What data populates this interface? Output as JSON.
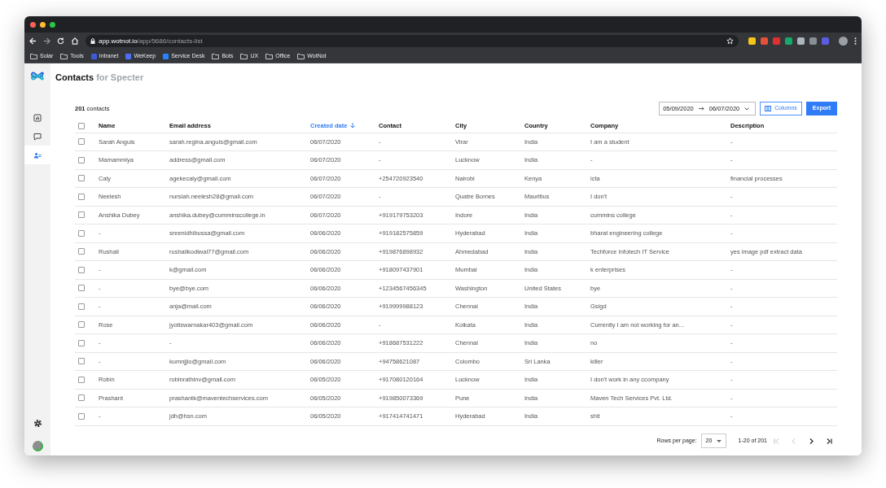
{
  "browser": {
    "url_host": "app.wotnot.io",
    "url_path": "/app/5686/contacts-list",
    "bookmarks": [
      {
        "kind": "folder",
        "label": "Solar"
      },
      {
        "kind": "folder",
        "label": "Tools"
      },
      {
        "kind": "app",
        "label": "Intranet",
        "color": "#3b5bdb"
      },
      {
        "kind": "app",
        "label": "WeKeep",
        "color": "#4c6ef5"
      },
      {
        "kind": "app",
        "label": "Service Desk",
        "color": "#2684ff"
      },
      {
        "kind": "folder",
        "label": "Bots"
      },
      {
        "kind": "folder",
        "label": "UX"
      },
      {
        "kind": "folder",
        "label": "Office"
      },
      {
        "kind": "folder",
        "label": "WotNot"
      }
    ],
    "extensions": [
      {
        "color": "#f5c518"
      },
      {
        "color": "#e55039"
      },
      {
        "color": "#e03131"
      },
      {
        "color": "#15aa6b"
      },
      {
        "color": "#adb5bd"
      },
      {
        "color": "#868e96"
      },
      {
        "color": "#5c5ce0"
      }
    ]
  },
  "sidebar": {
    "items": [
      {
        "kind": "chart",
        "selected": false
      },
      {
        "kind": "chat",
        "selected": false
      },
      {
        "kind": "contacts",
        "selected": true
      }
    ]
  },
  "page": {
    "title": "Contacts",
    "subtitle": "for Specter",
    "count": "**201** contacts",
    "date_from": "05/09/2020",
    "date_to": "06/07/2020",
    "columns_button": "Columns",
    "export_button": "Export"
  },
  "table": {
    "columns": [
      {
        "label": "Name",
        "sorted": false
      },
      {
        "label": "Email address",
        "sorted": false
      },
      {
        "label": "Created date",
        "sorted": true
      },
      {
        "label": "Contact",
        "sorted": false
      },
      {
        "label": "City",
        "sorted": false
      },
      {
        "label": "Country",
        "sorted": false
      },
      {
        "label": "Company",
        "sorted": false
      },
      {
        "label": "Description",
        "sorted": false
      }
    ],
    "header_checked": false,
    "rows": [
      {
        "checked": false,
        "cells": [
          "Sarah Anguis",
          "sarah.regina.anguis@gmail.com",
          "06/07/2020",
          "-",
          "Virar",
          "India",
          "I am a student",
          "-"
        ]
      },
      {
        "checked": false,
        "cells": [
          "Mamammiya",
          "address@gmail.com",
          "06/07/2020",
          "-",
          "Lucknow",
          "India",
          "-",
          "-"
        ]
      },
      {
        "checked": false,
        "cells": [
          "Caly",
          "agekecaly@gmail.com",
          "06/07/2020",
          "+254720923540",
          "Nairobi",
          "Kenya",
          "icta",
          "financial processes"
        ]
      },
      {
        "checked": false,
        "cells": [
          "Neelesh",
          "nursiah.neelesh28@gmail.com",
          "06/07/2020",
          "-",
          "Quatre Bornes",
          "Mauritius",
          "I don't",
          "-"
        ]
      },
      {
        "checked": false,
        "cells": [
          "Anshika Dubey",
          "anshika.dubey@cumminscollege.in",
          "06/07/2020",
          "+919179753203",
          "Indore",
          "India",
          "cummins college",
          "-"
        ]
      },
      {
        "checked": false,
        "cells": [
          "-",
          "sreenidhibussa@gmail.com",
          "06/06/2020",
          "+919182575859",
          "Hyderabad",
          "India",
          "bharat engineering college",
          "-"
        ]
      },
      {
        "checked": false,
        "cells": [
          "Rushali",
          "rushalikodiwal77@gmail.com",
          "06/06/2020",
          "+919876898932",
          "Ahmedabad",
          "India",
          "Techforce Infotech IT Service",
          "yes image pdf extract data"
        ]
      },
      {
        "checked": false,
        "cells": [
          "-",
          "k@gmail.com",
          "06/06/2020",
          "+918097437901",
          "Mumbai",
          "India",
          "k enterprises",
          "-"
        ]
      },
      {
        "checked": false,
        "cells": [
          "-",
          "bye@bye.com",
          "06/06/2020",
          "+1234567456345",
          "Washington",
          "United States",
          "bye",
          "-"
        ]
      },
      {
        "checked": false,
        "cells": [
          "-",
          "anja@mail.com",
          "06/06/2020",
          "+919999988123",
          "Chennai",
          "India",
          "Gsigd",
          "-"
        ]
      },
      {
        "checked": false,
        "cells": [
          "Rose",
          "jyotiswarnakar403@gmail.com",
          "06/06/2020",
          "-",
          "Kolkata",
          "India",
          "Currently I am not working for an...",
          "-"
        ]
      },
      {
        "checked": false,
        "cells": [
          "-",
          "-",
          "06/06/2020",
          "+918687531222",
          "Chennai",
          "India",
          "no",
          "-"
        ]
      },
      {
        "checked": false,
        "cells": [
          "-",
          "kumnjjio@gmail.com",
          "06/06/2020",
          "+94758621087",
          "Colombo",
          "Sri Lanka",
          "killer",
          "-"
        ]
      },
      {
        "checked": false,
        "cells": [
          "Robin",
          "robinrathinv@gmail.com",
          "06/05/2020",
          "+917080120164",
          "Lucknow",
          "India",
          "I don't work in any ccompany",
          "-"
        ]
      },
      {
        "checked": false,
        "cells": [
          "Prashant",
          "prashantk@maventechservices.com",
          "06/05/2020",
          "+919850073369",
          "Pune",
          "India",
          "Maven Tech Services Pvt. Ltd.",
          "-"
        ]
      },
      {
        "checked": false,
        "cells": [
          "-",
          "jdh@hsn.com",
          "06/05/2020",
          "+917414741471",
          "Hyderabad",
          "India",
          "shit",
          "-"
        ]
      }
    ]
  },
  "pagination": {
    "rows_label": "Rows per page:",
    "rows_value": "20",
    "range": "1-20 of 201"
  }
}
